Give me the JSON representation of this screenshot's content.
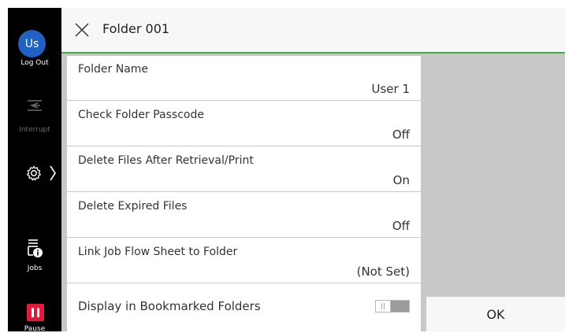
{
  "sidebar": {
    "avatar_text": "Us",
    "logout_label": "Log Out",
    "interrupt_label": "Interrupt",
    "jobs_label": "Jobs",
    "pause_label": "Pause"
  },
  "header": {
    "title": "Folder 001"
  },
  "settings": [
    {
      "label": "Folder Name",
      "value": "User 1"
    },
    {
      "label": "Check Folder Passcode",
      "value": "Off"
    },
    {
      "label": "Delete Files After Retrieval/Print",
      "value": "On"
    },
    {
      "label": "Delete Expired Files",
      "value": "Off"
    },
    {
      "label": "Link Job Flow Sheet to Folder",
      "value": "(Not Set)"
    },
    {
      "label": "Display in Bookmarked Folders",
      "toggle": "off"
    }
  ],
  "ok_label": "OK",
  "colors": {
    "accent_green": "#3fae4a",
    "avatar_blue": "#1f61c4",
    "pause_red": "#e5193a"
  }
}
